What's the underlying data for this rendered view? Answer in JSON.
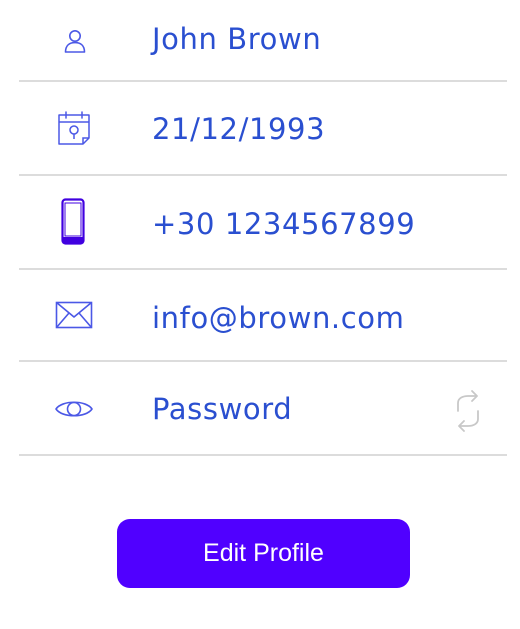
{
  "profile": {
    "name": "John Brown",
    "birthdate": "21/12/1993",
    "phone": "+30 1234567899",
    "email": "info@brown.com",
    "password_label": "Password"
  },
  "icons": {
    "name": "user-icon",
    "birthdate": "calendar-icon",
    "phone": "phone-icon",
    "email": "mail-icon",
    "password": "eye-icon",
    "refresh": "refresh-icon"
  },
  "actions": {
    "edit_profile_label": "Edit Profile"
  },
  "colors": {
    "text": "#2a4fd0",
    "icon": "#4b58e6",
    "divider": "#dcdcdc",
    "button": "#5000ff",
    "button_text": "#ffffff",
    "refresh_icon": "#c8c8c8"
  }
}
